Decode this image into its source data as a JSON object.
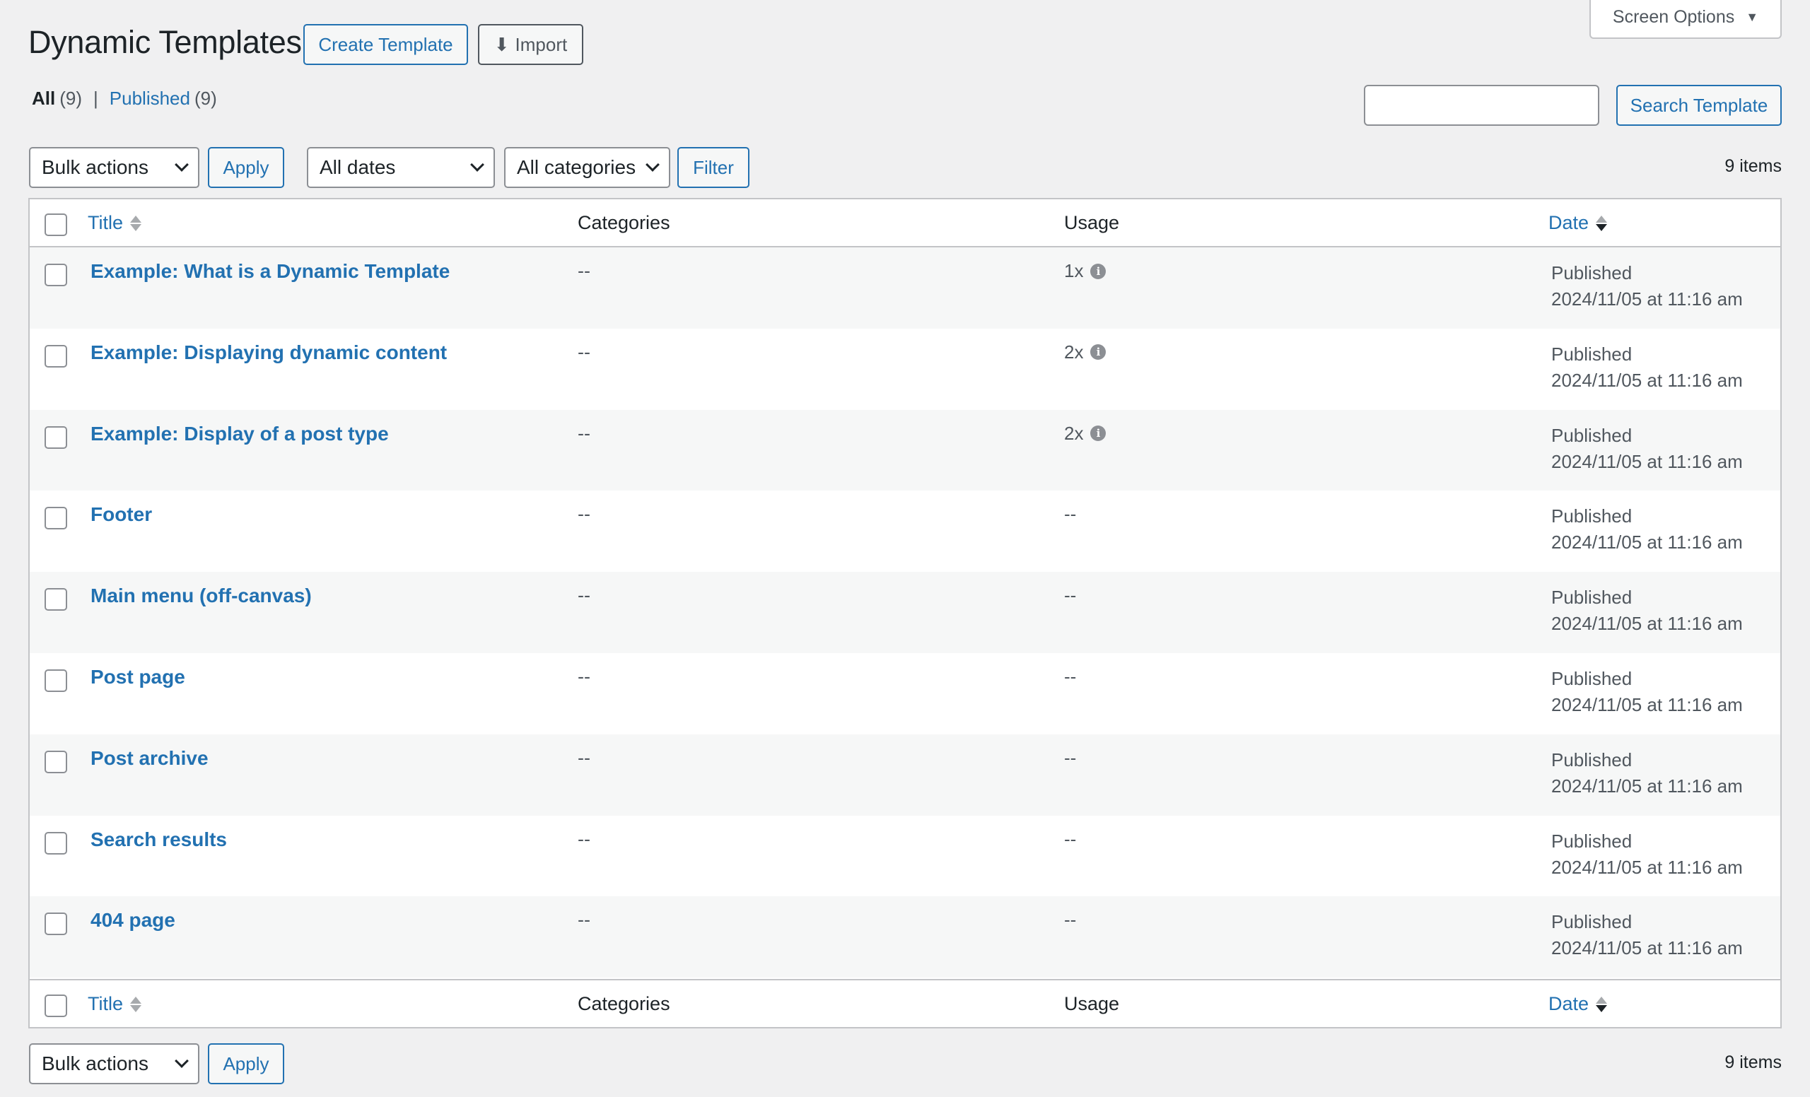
{
  "header": {
    "title": "Dynamic Templates",
    "create_label": "Create Template",
    "import_label": "Import",
    "screen_options_label": "Screen Options"
  },
  "views": {
    "all_label": "All",
    "all_count": "(9)",
    "published_label": "Published",
    "published_count": "(9)",
    "separator": "|"
  },
  "search": {
    "value": "",
    "button_label": "Search Template"
  },
  "tablenav": {
    "bulk_actions": "Bulk actions",
    "apply_label": "Apply",
    "dates_filter": "All dates",
    "categories_filter": "All categories",
    "filter_label": "Filter",
    "items_count": "9 items"
  },
  "table": {
    "columns": {
      "title": "Title",
      "categories": "Categories",
      "usage": "Usage",
      "date": "Date"
    },
    "rows": [
      {
        "title": "Example: What is a Dynamic Template",
        "categories": "--",
        "usage": "1x",
        "usage_info": true,
        "status": "Published",
        "date": "2024/11/05 at 11:16 am"
      },
      {
        "title": "Example: Displaying dynamic content",
        "categories": "--",
        "usage": "2x",
        "usage_info": true,
        "status": "Published",
        "date": "2024/11/05 at 11:16 am"
      },
      {
        "title": "Example: Display of a post type",
        "categories": "--",
        "usage": "2x",
        "usage_info": true,
        "status": "Published",
        "date": "2024/11/05 at 11:16 am"
      },
      {
        "title": "Footer",
        "categories": "--",
        "usage": "--",
        "usage_info": false,
        "status": "Published",
        "date": "2024/11/05 at 11:16 am"
      },
      {
        "title": "Main menu (off-canvas)",
        "categories": "--",
        "usage": "--",
        "usage_info": false,
        "status": "Published",
        "date": "2024/11/05 at 11:16 am"
      },
      {
        "title": "Post page",
        "categories": "--",
        "usage": "--",
        "usage_info": false,
        "status": "Published",
        "date": "2024/11/05 at 11:16 am"
      },
      {
        "title": "Post archive",
        "categories": "--",
        "usage": "--",
        "usage_info": false,
        "status": "Published",
        "date": "2024/11/05 at 11:16 am"
      },
      {
        "title": "Search results",
        "categories": "--",
        "usage": "--",
        "usage_info": false,
        "status": "Published",
        "date": "2024/11/05 at 11:16 am"
      },
      {
        "title": "404 page",
        "categories": "--",
        "usage": "--",
        "usage_info": false,
        "status": "Published",
        "date": "2024/11/05 at 11:16 am"
      }
    ]
  },
  "colors": {
    "link": "#2271b1",
    "background": "#f0f0f1",
    "border": "#c3c4c7",
    "alt_row": "#f6f7f7"
  },
  "icons": {
    "import": "download-arrow-icon",
    "screen_options": "triangle-down-icon",
    "usage_info": "info-icon",
    "sort": "sort-arrows-icon"
  }
}
